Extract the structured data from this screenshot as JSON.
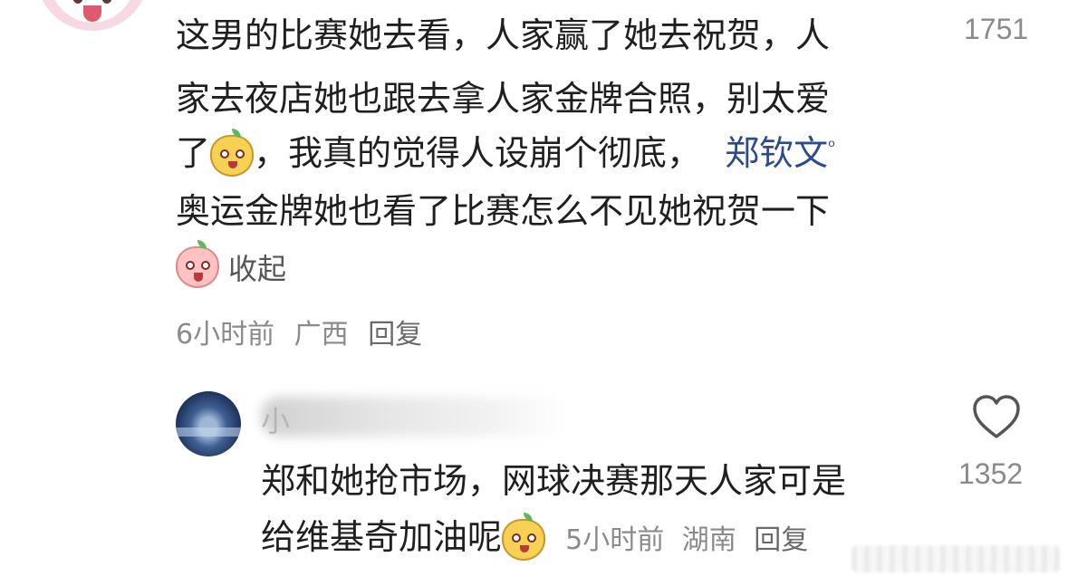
{
  "comment1": {
    "lines": [
      "这男的比赛她去看，人家赢了她去祝贺，人",
      "家去夜店她也跟去拿人家金牌合照，别太爱",
      "了",
      "，我真的觉得人设崩个彻底，",
      "奥运金牌她也看了比赛怎么不见她祝贺一下"
    ],
    "mention": "郑钦文",
    "likes": "1751",
    "collapse_label": "收起",
    "time": "6小时前",
    "location": "广西",
    "reply_label": "回复"
  },
  "comment2": {
    "username_visible": "小",
    "lines": [
      "郑和她抢市场，网球决赛那天人家可是",
      "给维基奇加油呢"
    ],
    "likes": "1352",
    "time": "5小时前",
    "location": "湖南",
    "reply_label": "回复"
  },
  "icons": {
    "like": "heart-outline-icon",
    "mention": "search-icon",
    "emoji_yellow": "cute-face-emoji",
    "emoji_pink": "pink-shocked-emoji"
  },
  "colors": {
    "text": "#1f1f1f",
    "meta": "#8a8a8a",
    "mention": "#2b4b8c"
  }
}
